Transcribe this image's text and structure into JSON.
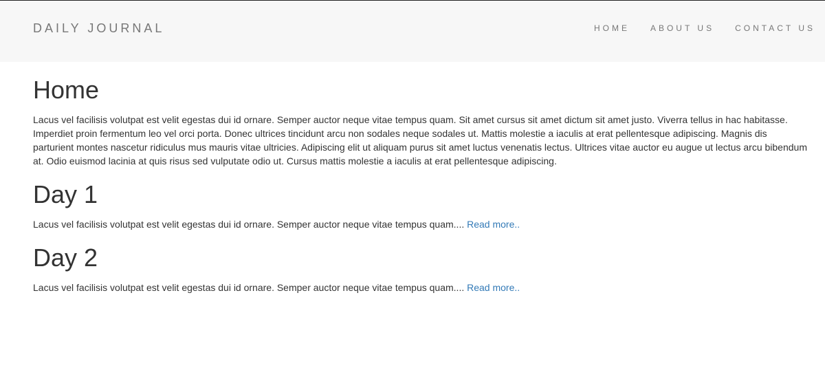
{
  "navbar": {
    "brand": "DAILY JOURNAL",
    "links": [
      {
        "label": "HOME"
      },
      {
        "label": "ABOUT US"
      },
      {
        "label": "CONTACT US"
      }
    ]
  },
  "main": {
    "title": "Home",
    "intro": "Lacus vel facilisis volutpat est velit egestas dui id ornare. Semper auctor neque vitae tempus quam. Sit amet cursus sit amet dictum sit amet justo. Viverra tellus in hac habitasse. Imperdiet proin fermentum leo vel orci porta. Donec ultrices tincidunt arcu non sodales neque sodales ut. Mattis molestie a iaculis at erat pellentesque adipiscing. Magnis dis parturient montes nascetur ridiculus mus mauris vitae ultricies. Adipiscing elit ut aliquam purus sit amet luctus venenatis lectus. Ultrices vitae auctor eu augue ut lectus arcu bibendum at. Odio euismod lacinia at quis risus sed vulputate odio ut. Cursus mattis molestie a iaculis at erat pellentesque adipiscing.",
    "posts": [
      {
        "title": "Day 1",
        "excerpt": "Lacus vel facilisis volutpat est velit egestas dui id ornare. Semper auctor neque vitae tempus quam....",
        "read_more": "Read more.."
      },
      {
        "title": "Day 2",
        "excerpt": "Lacus vel facilisis volutpat est velit egestas dui id ornare. Semper auctor neque vitae tempus quam....",
        "read_more": "Read more.."
      }
    ]
  },
  "colors": {
    "navbar_bg": "#f7f7f7",
    "nav_text": "#777777",
    "body_text": "#333333",
    "link": "#337ab7"
  }
}
